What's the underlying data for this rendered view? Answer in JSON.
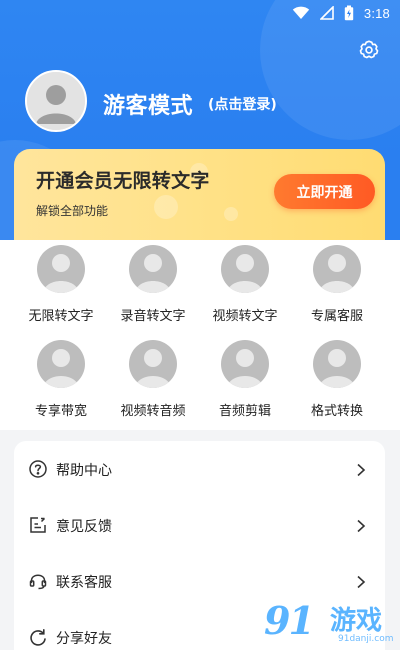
{
  "status_bar": {
    "time": "3:18",
    "icons": [
      "wifi-icon",
      "signal-icon",
      "battery-icon"
    ]
  },
  "header": {
    "settings_icon": "gear-icon",
    "profile": {
      "name": "游客模式",
      "login_hint": "(点击登录)"
    }
  },
  "vip": {
    "title": "开通会员无限转文字",
    "subtitle": "解锁全部功能",
    "button_label": "立即开通"
  },
  "features": [
    {
      "label": "无限转文字"
    },
    {
      "label": "录音转文字"
    },
    {
      "label": "视频转文字"
    },
    {
      "label": "专属客服"
    },
    {
      "label": "专享带宽"
    },
    {
      "label": "视频转音频"
    },
    {
      "label": "音频剪辑"
    },
    {
      "label": "格式转换"
    }
  ],
  "menu": [
    {
      "label": "帮助中心",
      "icon": "question-circle-icon"
    },
    {
      "label": "意见反馈",
      "icon": "edit-feedback-icon"
    },
    {
      "label": "联系客服",
      "icon": "headset-icon"
    },
    {
      "label": "分享好友",
      "icon": "share-icon"
    }
  ],
  "watermark": {
    "number": "91",
    "text": "游戏",
    "url": "91danji.com"
  },
  "colors": {
    "header_blue": "#2a7ff0",
    "vip_gold": "#ffe28a",
    "vip_button": "#ff5a24",
    "background": "#f3f4f6"
  }
}
